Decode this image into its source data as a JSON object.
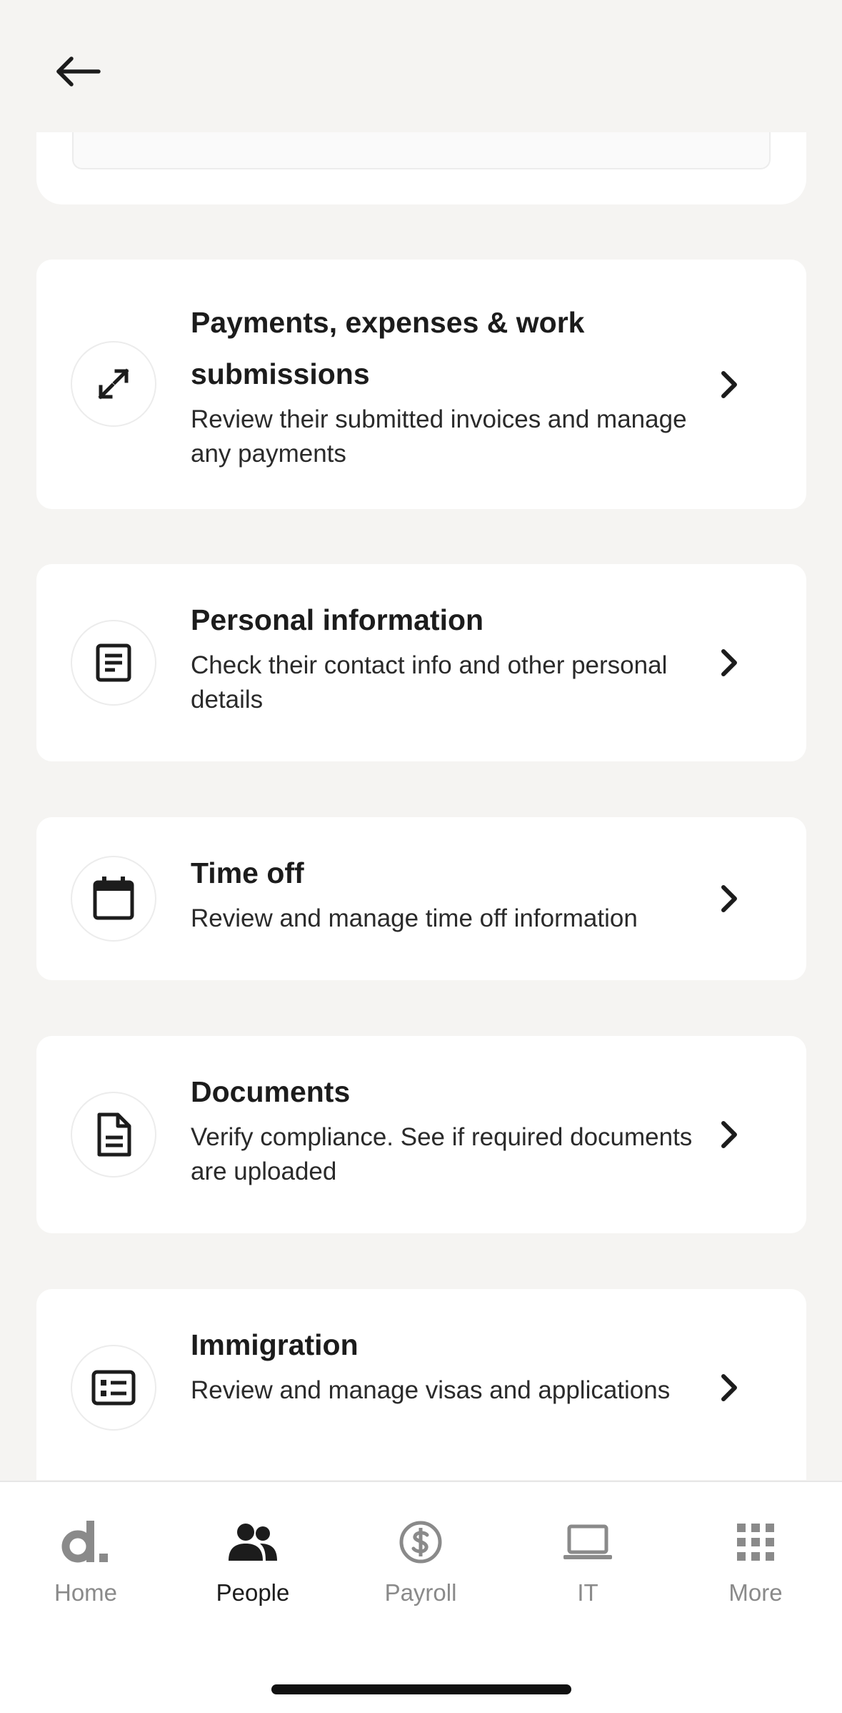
{
  "header": {
    "back_label": "Back"
  },
  "cards": [
    {
      "title": "Payments, expenses & work submissions",
      "description": "Review their submitted invoices and manage any payments",
      "icon": "arrows-expand-icon"
    },
    {
      "title": "Personal information",
      "description": "Check their contact info and other personal details",
      "icon": "document-lines-icon"
    },
    {
      "title": "Time off",
      "description": "Review and manage time off information",
      "icon": "calendar-icon"
    },
    {
      "title": "Documents",
      "description": "Verify compliance. See if required documents are uploaded",
      "icon": "file-icon"
    },
    {
      "title": "Immigration",
      "description": "Review and manage visas and applications",
      "icon": "id-card-icon"
    }
  ],
  "tabbar": {
    "tabs": [
      {
        "label": "Home",
        "icon": "deel-logo-icon",
        "active": false
      },
      {
        "label": "People",
        "icon": "people-icon",
        "active": true
      },
      {
        "label": "Payroll",
        "icon": "dollar-icon",
        "active": false
      },
      {
        "label": "IT",
        "icon": "laptop-icon",
        "active": false
      },
      {
        "label": "More",
        "icon": "grid-icon",
        "active": false
      }
    ]
  },
  "colors": {
    "background": "#f5f4f2",
    "card": "#ffffff",
    "text": "#1c1c1c",
    "inactive_tab": "#8a8a8a"
  }
}
